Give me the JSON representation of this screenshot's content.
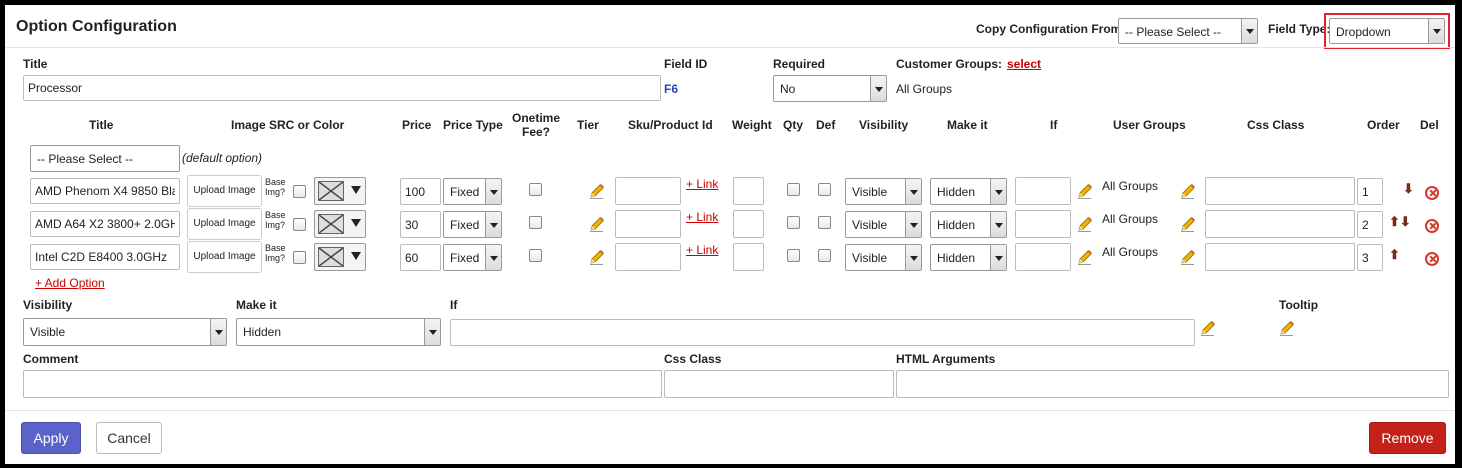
{
  "header": {
    "title": "Option Configuration",
    "copy_label": "Copy Configuration From:",
    "copy_value": "-- Please Select --",
    "field_type_label": "Field Type:",
    "field_type_value": "Dropdown",
    "highlight_color": "#e0242b"
  },
  "field": {
    "title_label": "Title",
    "title_value": "Processor",
    "field_id_label": "Field ID",
    "field_id_value": "F6",
    "required_label": "Required",
    "required_value": "No",
    "customer_groups_label": "Customer Groups:",
    "customer_groups_link": "select",
    "customer_groups_value": "All Groups"
  },
  "columns": [
    "Title",
    "Image SRC or Color",
    "Price",
    "Price Type",
    "Onetime Fee?",
    "Tier",
    "Sku/Product Id",
    "Weight",
    "Qty",
    "Def",
    "Visibility",
    "Make it",
    "If",
    "User Groups",
    "Css Class",
    "Order",
    "Del"
  ],
  "default_option": {
    "select_value": "-- Please Select --",
    "note": "(default option)"
  },
  "options": [
    {
      "title": "AMD Phenom X4 9850 Bla",
      "upload": "Upload Image",
      "base_img": "Base Img?",
      "price": "100",
      "price_type": "Fixed",
      "link": "+ Link",
      "visibility": "Visible",
      "make_it": "Hidden",
      "user_groups": "All Groups",
      "order": "1",
      "arrows": "⬇"
    },
    {
      "title": "AMD A64 X2 3800+ 2.0GH",
      "upload": "Upload Image",
      "base_img": "Base Img?",
      "price": "30",
      "price_type": "Fixed",
      "link": "+ Link",
      "visibility": "Visible",
      "make_it": "Hidden",
      "user_groups": "All Groups",
      "order": "2",
      "arrows": "⬆⬇"
    },
    {
      "title": "Intel C2D E8400 3.0GHz",
      "upload": "Upload Image",
      "base_img": "Base Img?",
      "price": "60",
      "price_type": "Fixed",
      "link": "+ Link",
      "visibility": "Visible",
      "make_it": "Hidden",
      "user_groups": "All Groups",
      "order": "3",
      "arrows": "⬆"
    }
  ],
  "add_option": "+ Add Option",
  "bottom": {
    "visibility_label": "Visibility",
    "visibility_value": "Visible",
    "make_it_label": "Make it",
    "make_it_value": "Hidden",
    "if_label": "If",
    "tooltip_label": "Tooltip",
    "comment_label": "Comment",
    "css_class_label": "Css Class",
    "html_args_label": "HTML Arguments"
  },
  "footer": {
    "apply": "Apply",
    "cancel": "Cancel",
    "remove": "Remove",
    "apply_color": "#5b62c9",
    "remove_color": "#c4211b"
  }
}
